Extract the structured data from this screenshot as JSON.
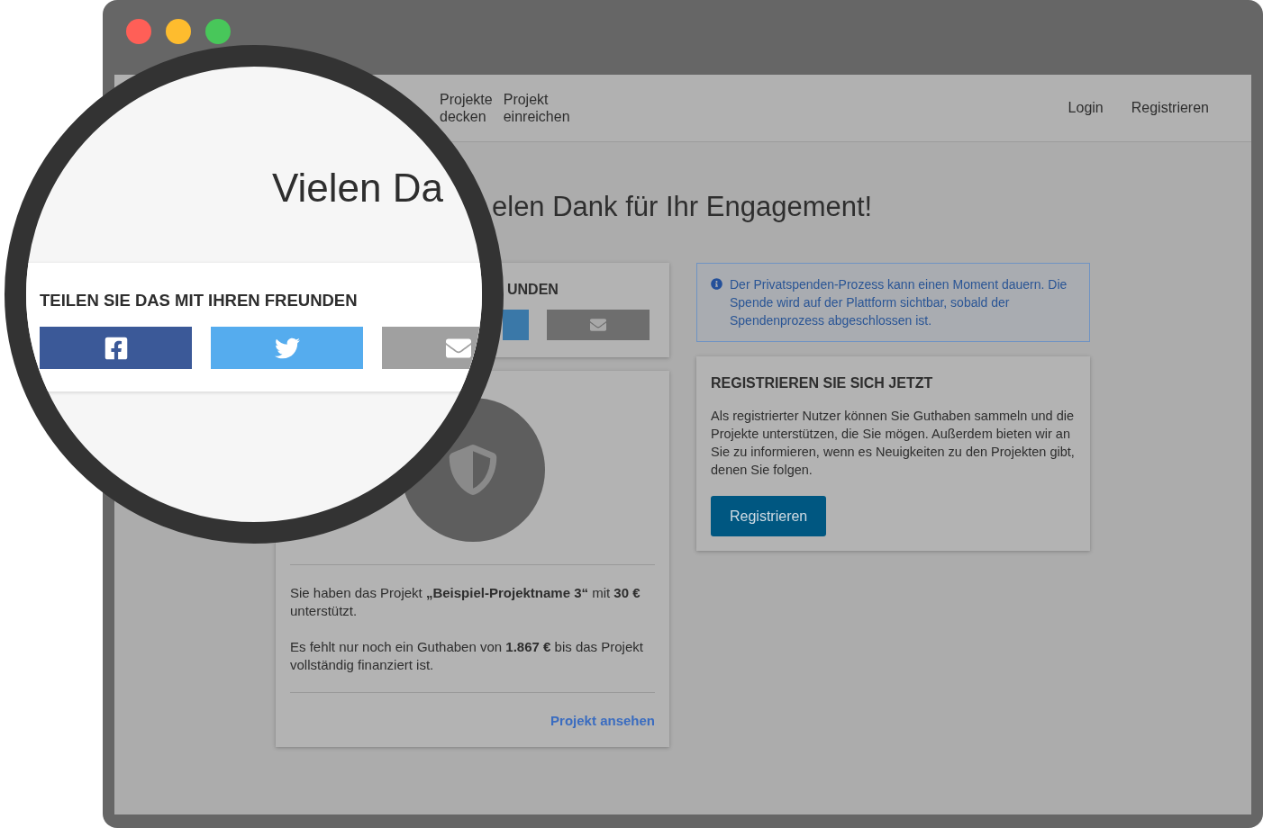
{
  "window_controls": [
    {
      "color": "#ff5f57"
    },
    {
      "color": "#febc2e"
    },
    {
      "color": "#48c75a"
    }
  ],
  "nav": {
    "items": [
      {
        "lines": [
          "Projekte",
          "decken"
        ]
      },
      {
        "lines": [
          "Projekt",
          "einreichen"
        ]
      }
    ],
    "account_links": [
      "Login",
      "Registrieren"
    ]
  },
  "heading": "elen Dank für Ihr Engagement!",
  "share_card": {
    "heading": "UNDEN",
    "buttons": [
      {
        "kind": "twitter"
      },
      {
        "kind": "email"
      }
    ]
  },
  "project_card": {
    "support_text": "Sie haben das Projekt **„Beispiel-Projektname 3“** mit **30 €** unterstützt.",
    "remaining_text": "Es fehlt nur noch ein Guthaben von **1.867 €** bis das Projekt vollständig finanziert ist.",
    "link": "Projekt ansehen"
  },
  "info_box": {
    "text": "Der Privatspenden-Prozess kann einen Moment dauern. Die Spende wird auf der Plattform sichtbar, sobald der Spendenprozess abgeschlossen ist."
  },
  "register_card": {
    "heading": "REGISTRIEREN SIE SICH JETZT",
    "text": "Als registrierter Nutzer können Sie Guthaben sammeln und die Projekte unterstützen, die Sie mögen. Außerdem bieten wir an Sie zu informieren, wenn es Neuigkeiten zu den Projekten gibt, denen Sie folgen.",
    "button": "Registrieren"
  },
  "magnifier": {
    "heading": "Vielen Da",
    "share_heading": "TEILEN SIE DAS MIT IHREN FREUNDEN",
    "share_buttons": [
      {
        "kind": "facebook"
      },
      {
        "kind": "twitter"
      },
      {
        "kind": "email"
      }
    ]
  }
}
